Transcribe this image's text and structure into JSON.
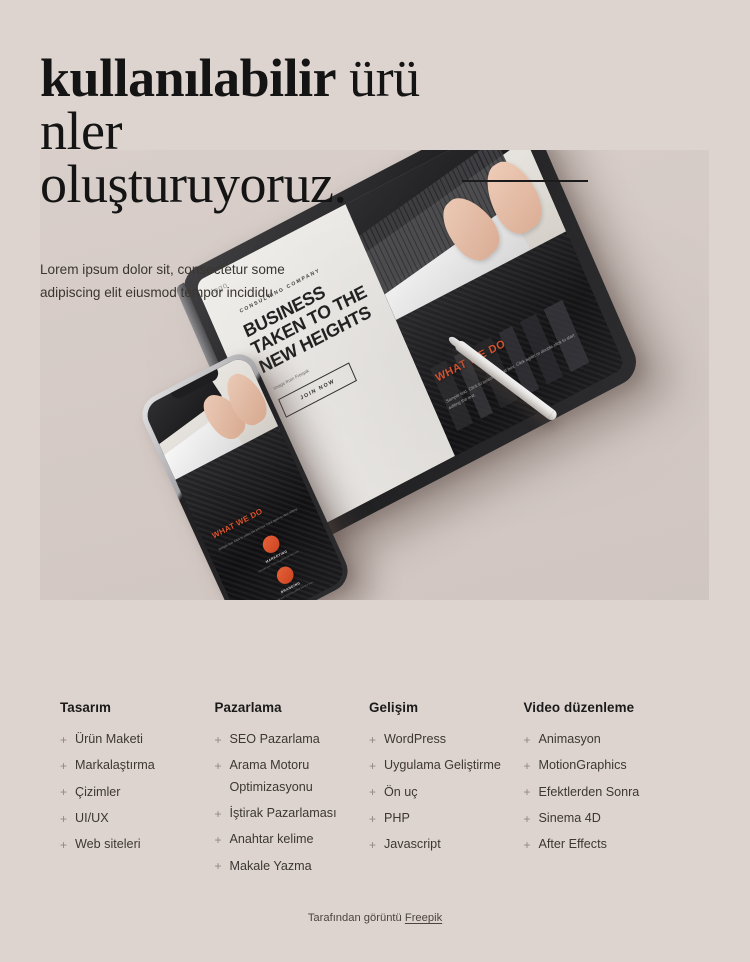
{
  "hero": {
    "headline_bold": "kullanılabilir",
    "headline_rest": " ürü nler oluşturuyoruz.",
    "headline_line1_bold": "kullanılabilir",
    "headline_line1_rest": " ürü",
    "headline_line2": "nler",
    "headline_line3": "oluşturuyoruz.",
    "lede": "Lorem ipsum dolor sit, consectetur some adipiscing elit eiusmod tempor incididu",
    "rule": "divider-rule"
  },
  "mockup": {
    "tablet": {
      "logo": "logo",
      "eyebrow": "CONSULTING COMPANY",
      "headline_line1": "BUSINESS",
      "headline_line2": "TAKEN TO THE",
      "headline_line3": "NEW HEIGHTS",
      "subtext": "Image from Freepik",
      "button": "JOIN NOW",
      "section_title": "WHAT WE DO",
      "body": "Sample text. Click to select the text box. Click again or double click to start editing the text."
    },
    "phone": {
      "section_title": "WHAT WE DO",
      "blurb": "Sample text. Click to select the text box. Click again to start editing.",
      "features": [
        {
          "title": "MARKETING",
          "text": "Sample text. Click to select the text box."
        },
        {
          "title": "BRANDING",
          "text": "Sample text. Click to select the text box."
        }
      ]
    },
    "stylus": "stylus-pen"
  },
  "columns": [
    {
      "title": "Tasarım",
      "items": [
        {
          "label": "Ürün Maketi",
          "sub": false
        },
        {
          "label": "Markalaştırma",
          "sub": false
        },
        {
          "label": "Çizimler",
          "sub": false
        },
        {
          "label": "UI/UX",
          "sub": false
        },
        {
          "label": "Web siteleri",
          "sub": false
        }
      ]
    },
    {
      "title": "Pazarlama",
      "items": [
        {
          "label": "SEO Pazarlama",
          "sub": false
        },
        {
          "label": "Arama Motoru",
          "sub": false
        },
        {
          "label": "Optimizasyonu",
          "sub": true
        },
        {
          "label": "İştirak Pazarlaması",
          "sub": false
        },
        {
          "label": "Anahtar kelime",
          "sub": false
        },
        {
          "label": "Makale Yazma",
          "sub": false
        }
      ]
    },
    {
      "title": "Gelişim",
      "items": [
        {
          "label": "WordPress",
          "sub": false
        },
        {
          "label": "Uygulama Geliştirme",
          "sub": false
        },
        {
          "label": "Ön uç",
          "sub": false
        },
        {
          "label": "PHP",
          "sub": false
        },
        {
          "label": "Javascript",
          "sub": false
        }
      ]
    },
    {
      "title": "Video düzenleme",
      "items": [
        {
          "label": "Animasyon",
          "sub": false
        },
        {
          "label": "MotionGraphics",
          "sub": false
        },
        {
          "label": "Efektlerden Sonra",
          "sub": false
        },
        {
          "label": "Sinema 4D",
          "sub": false
        },
        {
          "label": "After Effects",
          "sub": false
        }
      ]
    }
  ],
  "credit": {
    "text": "Tarafından görüntü ",
    "link": "Freepik"
  },
  "colors": {
    "page_background": "#ded4cf",
    "photo_background": "#d7ccc7",
    "heading": "#141414",
    "body_text": "#3b3733",
    "plus_icon": "#8f8781",
    "accent_orange": "#e0522c"
  },
  "icons": {
    "plus": "+"
  }
}
